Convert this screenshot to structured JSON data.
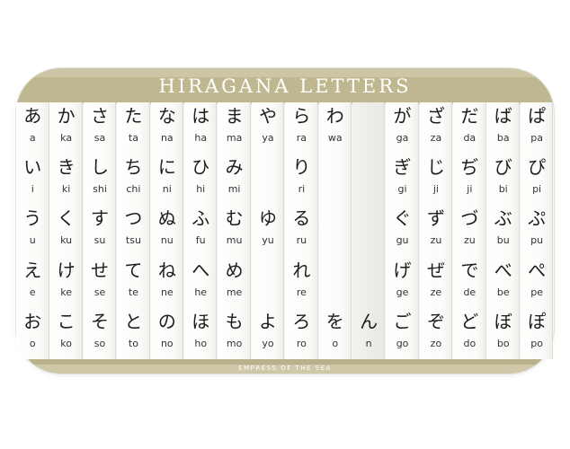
{
  "chart": {
    "title": "HIRAGANA LETTERS",
    "footer": "EMPRESS OF THE SEA"
  },
  "columns": [
    {
      "cells": [
        {
          "kana": "あ",
          "romaji": "a"
        },
        {
          "kana": "い",
          "romaji": "i"
        },
        {
          "kana": "う",
          "romaji": "u"
        },
        {
          "kana": "え",
          "romaji": "e"
        },
        {
          "kana": "お",
          "romaji": "o"
        }
      ]
    },
    {
      "cells": [
        {
          "kana": "か",
          "romaji": "ka"
        },
        {
          "kana": "き",
          "romaji": "ki"
        },
        {
          "kana": "く",
          "romaji": "ku"
        },
        {
          "kana": "け",
          "romaji": "ke"
        },
        {
          "kana": "こ",
          "romaji": "ko"
        }
      ]
    },
    {
      "cells": [
        {
          "kana": "さ",
          "romaji": "sa"
        },
        {
          "kana": "し",
          "romaji": "shi"
        },
        {
          "kana": "す",
          "romaji": "su"
        },
        {
          "kana": "せ",
          "romaji": "se"
        },
        {
          "kana": "そ",
          "romaji": "so"
        }
      ]
    },
    {
      "cells": [
        {
          "kana": "た",
          "romaji": "ta"
        },
        {
          "kana": "ち",
          "romaji": "chi"
        },
        {
          "kana": "つ",
          "romaji": "tsu"
        },
        {
          "kana": "て",
          "romaji": "te"
        },
        {
          "kana": "と",
          "romaji": "to"
        }
      ]
    },
    {
      "cells": [
        {
          "kana": "な",
          "romaji": "na"
        },
        {
          "kana": "に",
          "romaji": "ni"
        },
        {
          "kana": "ぬ",
          "romaji": "nu"
        },
        {
          "kana": "ね",
          "romaji": "ne"
        },
        {
          "kana": "の",
          "romaji": "no"
        }
      ]
    },
    {
      "cells": [
        {
          "kana": "は",
          "romaji": "ha"
        },
        {
          "kana": "ひ",
          "romaji": "hi"
        },
        {
          "kana": "ふ",
          "romaji": "fu"
        },
        {
          "kana": "へ",
          "romaji": "he"
        },
        {
          "kana": "ほ",
          "romaji": "ho"
        }
      ]
    },
    {
      "cells": [
        {
          "kana": "ま",
          "romaji": "ma"
        },
        {
          "kana": "み",
          "romaji": "mi"
        },
        {
          "kana": "む",
          "romaji": "mu"
        },
        {
          "kana": "め",
          "romaji": "me"
        },
        {
          "kana": "も",
          "romaji": "mo"
        }
      ]
    },
    {
      "cells": [
        {
          "kana": "や",
          "romaji": "ya"
        },
        {
          "kana": "",
          "romaji": ""
        },
        {
          "kana": "ゆ",
          "romaji": "yu"
        },
        {
          "kana": "",
          "romaji": ""
        },
        {
          "kana": "よ",
          "romaji": "yo"
        }
      ]
    },
    {
      "cells": [
        {
          "kana": "ら",
          "romaji": "ra"
        },
        {
          "kana": "り",
          "romaji": "ri"
        },
        {
          "kana": "る",
          "romaji": "ru"
        },
        {
          "kana": "れ",
          "romaji": "re"
        },
        {
          "kana": "ろ",
          "romaji": "ro"
        }
      ]
    },
    {
      "cells": [
        {
          "kana": "わ",
          "romaji": "wa"
        },
        {
          "kana": "",
          "romaji": ""
        },
        {
          "kana": "",
          "romaji": ""
        },
        {
          "kana": "",
          "romaji": ""
        },
        {
          "kana": "を",
          "romaji": "o"
        }
      ]
    },
    {
      "cells": [
        {
          "kana": "",
          "romaji": ""
        },
        {
          "kana": "",
          "romaji": ""
        },
        {
          "kana": "",
          "romaji": ""
        },
        {
          "kana": "",
          "romaji": ""
        },
        {
          "kana": "ん",
          "romaji": "n"
        }
      ]
    },
    {
      "cells": [
        {
          "kana": "が",
          "romaji": "ga"
        },
        {
          "kana": "ぎ",
          "romaji": "gi"
        },
        {
          "kana": "ぐ",
          "romaji": "gu"
        },
        {
          "kana": "げ",
          "romaji": "ge"
        },
        {
          "kana": "ご",
          "romaji": "go"
        }
      ]
    },
    {
      "cells": [
        {
          "kana": "ざ",
          "romaji": "za"
        },
        {
          "kana": "じ",
          "romaji": "ji"
        },
        {
          "kana": "ず",
          "romaji": "zu"
        },
        {
          "kana": "ぜ",
          "romaji": "ze"
        },
        {
          "kana": "ぞ",
          "romaji": "zo"
        }
      ]
    },
    {
      "cells": [
        {
          "kana": "だ",
          "romaji": "da"
        },
        {
          "kana": "ぢ",
          "romaji": "ji"
        },
        {
          "kana": "づ",
          "romaji": "zu"
        },
        {
          "kana": "で",
          "romaji": "de"
        },
        {
          "kana": "ど",
          "romaji": "do"
        }
      ]
    },
    {
      "cells": [
        {
          "kana": "ば",
          "romaji": "ba"
        },
        {
          "kana": "び",
          "romaji": "bi"
        },
        {
          "kana": "ぶ",
          "romaji": "bu"
        },
        {
          "kana": "べ",
          "romaji": "be"
        },
        {
          "kana": "ぼ",
          "romaji": "bo"
        }
      ]
    },
    {
      "cells": [
        {
          "kana": "ぱ",
          "romaji": "pa"
        },
        {
          "kana": "ぴ",
          "romaji": "pi"
        },
        {
          "kana": "ぷ",
          "romaji": "pu"
        },
        {
          "kana": "ぺ",
          "romaji": "pe"
        },
        {
          "kana": "ぽ",
          "romaji": "po"
        }
      ]
    }
  ],
  "colors": {
    "band": "#bfb78f",
    "band_light": "#cdc6a6",
    "mat": "#f4f3ee",
    "strip": "#ffffff"
  }
}
